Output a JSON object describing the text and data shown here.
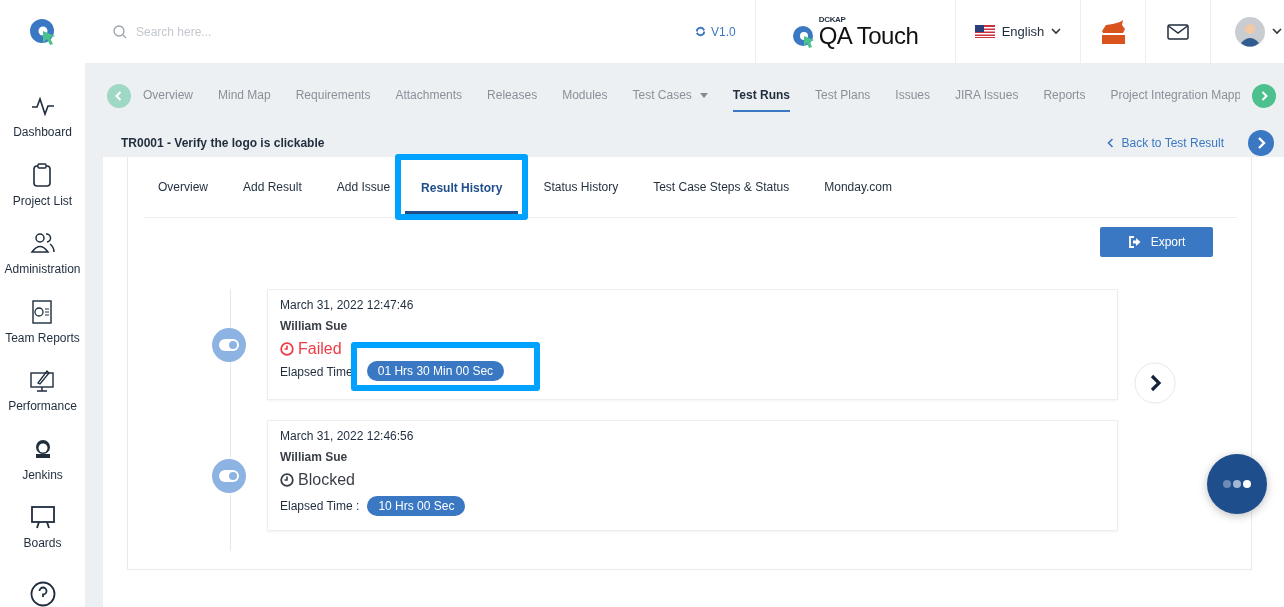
{
  "topbar": {
    "search": {
      "placeholder": "Search here..."
    },
    "version": "V1.0",
    "brand": {
      "over": "DCKAP",
      "name": "QA Touch"
    },
    "language": "English"
  },
  "sidebar": {
    "items": [
      {
        "label": "Dashboard",
        "kind": "pulse"
      },
      {
        "label": "Project List",
        "kind": "clipboard"
      },
      {
        "label": "Administration",
        "kind": "users"
      },
      {
        "label": "Team Reports",
        "kind": "report"
      },
      {
        "label": "Performance",
        "kind": "rocket"
      },
      {
        "label": "Jenkins",
        "kind": "jenkins"
      },
      {
        "label": "Boards",
        "kind": "board"
      }
    ]
  },
  "project_nav": {
    "items": [
      {
        "label": "Overview",
        "selected": false,
        "dropdown": false
      },
      {
        "label": "Mind Map",
        "selected": false,
        "dropdown": false
      },
      {
        "label": "Requirements",
        "selected": false,
        "dropdown": false
      },
      {
        "label": "Attachments",
        "selected": false,
        "dropdown": false
      },
      {
        "label": "Releases",
        "selected": false,
        "dropdown": false
      },
      {
        "label": "Modules",
        "selected": false,
        "dropdown": false
      },
      {
        "label": "Test Cases",
        "selected": false,
        "dropdown": true
      },
      {
        "label": "Test Runs",
        "selected": true,
        "dropdown": false
      },
      {
        "label": "Test Plans",
        "selected": false,
        "dropdown": false
      },
      {
        "label": "Issues",
        "selected": false,
        "dropdown": false
      },
      {
        "label": "JIRA Issues",
        "selected": false,
        "dropdown": false
      },
      {
        "label": "Reports",
        "selected": false,
        "dropdown": false
      },
      {
        "label": "Project Integration Mapp",
        "selected": false,
        "dropdown": false
      }
    ]
  },
  "test_run": {
    "title": "TR0001 - Verify the logo is clickable",
    "back_link": "Back to Test Result"
  },
  "detail_tabs": [
    {
      "label": "Overview",
      "selected": false,
      "highlighted": false
    },
    {
      "label": "Add Result",
      "selected": false,
      "highlighted": false
    },
    {
      "label": "Add Issue",
      "selected": false,
      "highlighted": false
    },
    {
      "label": "Result History",
      "selected": true,
      "highlighted": true
    },
    {
      "label": "Status History",
      "selected": false,
      "highlighted": false
    },
    {
      "label": "Test Case Steps & Status",
      "selected": false,
      "highlighted": false
    },
    {
      "label": "Monday.com",
      "selected": false,
      "highlighted": false
    }
  ],
  "export_button": "Export",
  "history": [
    {
      "timestamp": "March 31, 2022 12:47:46",
      "user": "William Sue",
      "status": "Failed",
      "kind": "failed",
      "elapsed_label": "Elapsed Time",
      "elapsed": "01 Hrs 30 Min 00 Sec",
      "highlighted": true
    },
    {
      "timestamp": "March 31, 2022 12:46:56",
      "user": "William Sue",
      "status": "Blocked",
      "kind": "blocked",
      "elapsed_label": "Elapsed Time :",
      "elapsed": "10 Hrs 00 Sec",
      "highlighted": false
    }
  ]
}
